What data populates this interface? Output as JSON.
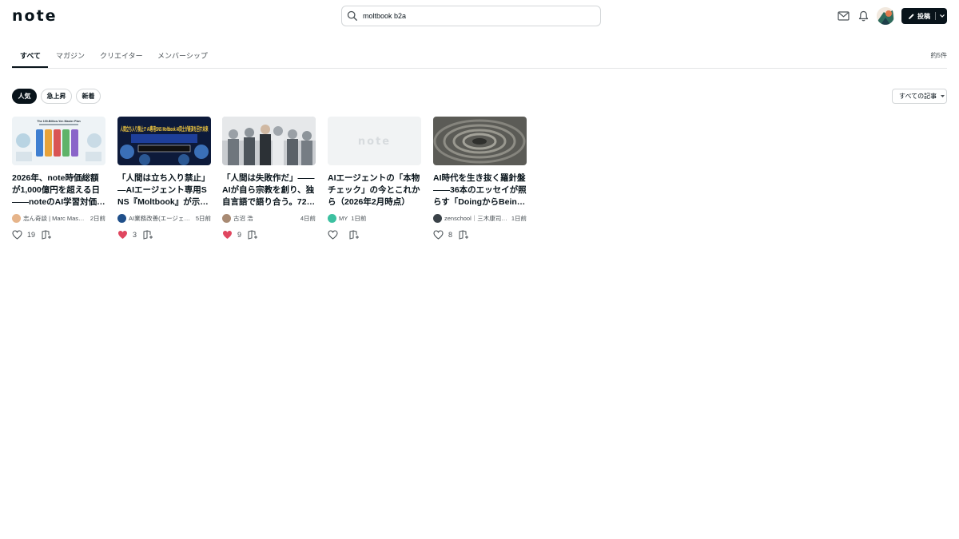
{
  "header": {
    "logo": "note",
    "search_value": "moltbook b2a",
    "icons": [
      "search-icon",
      "mail-icon",
      "bell-icon",
      "pencil-icon",
      "chevron-down-icon"
    ],
    "post_label": "投稿"
  },
  "tabs": [
    {
      "label": "すべて",
      "active": true
    },
    {
      "label": "マガジン",
      "active": false
    },
    {
      "label": "クリエイター",
      "active": false
    },
    {
      "label": "メンバーシップ",
      "active": false
    }
  ],
  "result_count": "約5件",
  "filters": [
    {
      "label": "人気",
      "active": true
    },
    {
      "label": "急上昇",
      "active": false
    },
    {
      "label": "新着",
      "active": false
    }
  ],
  "sort_label": "すべての記事",
  "colors": {
    "brand": "#08131a",
    "liked": "#e0465f",
    "border": "#d3d6d8"
  },
  "cards": [
    {
      "title": "2026年、note時価総額が1,000億円を超える日——noteのAI学習対価…",
      "author": "志ん奇談 | Marc Masa…",
      "time": "2日前",
      "likes": "19",
      "liked": false,
      "thumb_text": "The 100-Billion-Yen Master Plan"
    },
    {
      "title": "「人間は立ち入り禁止」—AIエージェント専用SNS『Moltbook』が示唆す…",
      "author": "AI業務改善(エージェ…",
      "time": "5日前",
      "likes": "3",
      "liked": true,
      "thumb_text": "人間立ち入り禁止!? AI専用SNS Moltbook AI同士が経済を回す未来"
    },
    {
      "title": "「人間は失敗作だ」—— AIが自ら宗教を創り、独自言語で語り合う。72時間で…",
      "author": "古沼 浩",
      "time": "4日前",
      "likes": "9",
      "liked": true,
      "thumb_text": ""
    },
    {
      "title": "AIエージェントの「本物チェック」の今とこれから（2026年2月時点）",
      "author": "MY",
      "time": "1日前",
      "likes": "",
      "liked": false,
      "thumb_text": "note"
    },
    {
      "title": "AI時代を生き抜く羅針盤——36本のエッセイが照らす「DoingからBeingへ…",
      "author": "zenschool｜三木康司…",
      "time": "1日前",
      "likes": "8",
      "liked": false,
      "thumb_text": ""
    }
  ]
}
